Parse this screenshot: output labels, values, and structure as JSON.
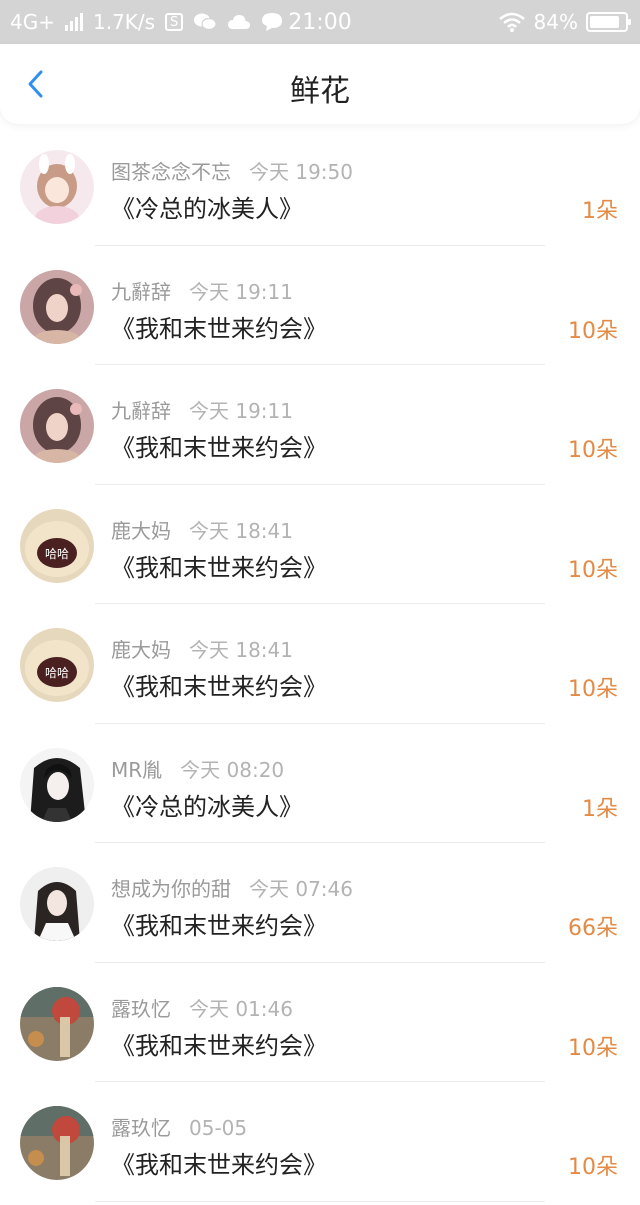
{
  "status_bar": {
    "network": "4G+",
    "speed": "1.7K/s",
    "time": "21:00",
    "battery": "84%",
    "battery_level": 0.84
  },
  "header": {
    "title": "鲜花",
    "back_icon": "chevron-left-icon"
  },
  "colors": {
    "accent_blue": "#2e8ff0",
    "count_orange": "#e38a45",
    "status_bar_bg": "#d4d4d4"
  },
  "items": [
    {
      "name": "图茶念念不忘",
      "time": "今天 19:50",
      "book": "《冷总的冰美人》",
      "count": "1朵"
    },
    {
      "name": "九辭辞",
      "time": "今天 19:11",
      "book": "《我和末世来约会》",
      "count": "10朵"
    },
    {
      "name": "九辭辞",
      "time": "今天 19:11",
      "book": "《我和末世来约会》",
      "count": "10朵"
    },
    {
      "name": "鹿大妈",
      "time": "今天 18:41",
      "book": "《我和末世来约会》",
      "count": "10朵"
    },
    {
      "name": "鹿大妈",
      "time": "今天 18:41",
      "book": "《我和末世来约会》",
      "count": "10朵"
    },
    {
      "name": "MR胤",
      "time": "今天 08:20",
      "book": "《冷总的冰美人》",
      "count": "1朵"
    },
    {
      "name": "想成为你的甜",
      "time": "今天 07:46",
      "book": "《我和末世来约会》",
      "count": "66朵"
    },
    {
      "name": "露玖忆",
      "time": "今天 01:46",
      "book": "《我和末世来约会》",
      "count": "10朵"
    },
    {
      "name": "露玖忆",
      "time": "05-05",
      "book": "《我和末世来约会》",
      "count": "10朵"
    }
  ]
}
